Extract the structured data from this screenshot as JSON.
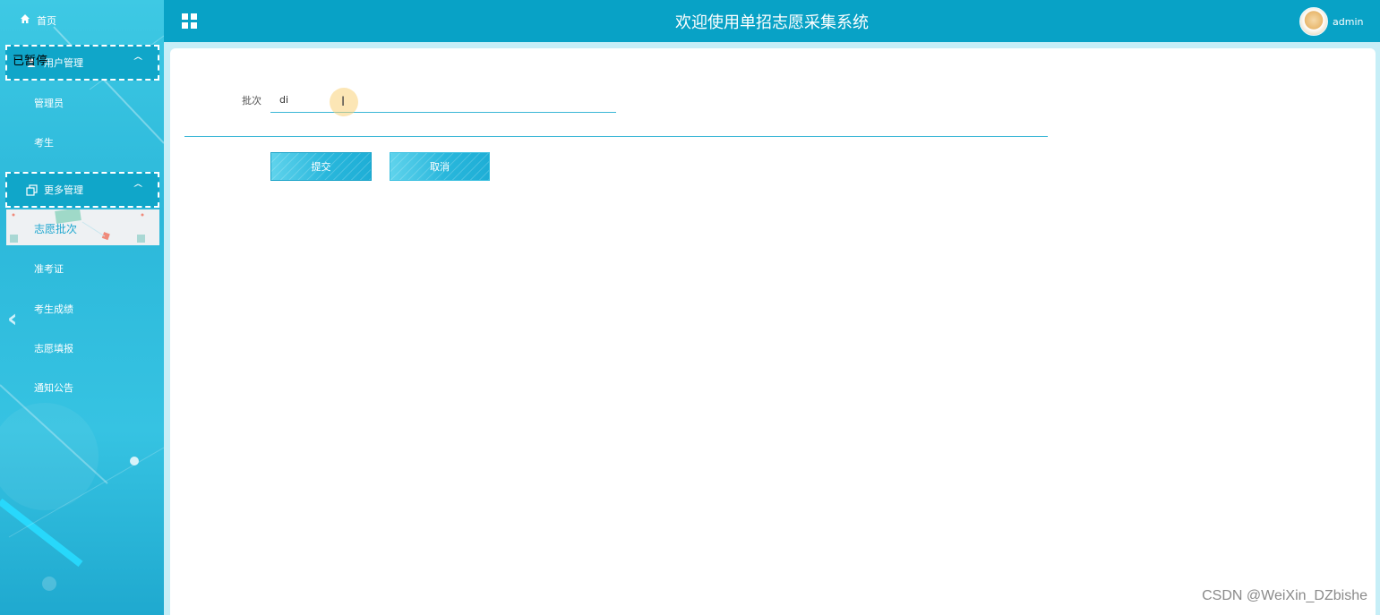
{
  "sidebar": {
    "home_label": "首页",
    "paused_label": "已暂停",
    "groups": [
      {
        "label": "用户管理",
        "caret": "^",
        "items": [
          "管理员",
          "考生"
        ]
      },
      {
        "label": "更多管理",
        "caret": "^",
        "items": [
          "志愿批次",
          "准考证",
          "考生成绩",
          "志愿填报",
          "通知公告"
        ]
      }
    ],
    "active_item": "志愿批次"
  },
  "header": {
    "title": "欢迎使用单招志愿采集系统",
    "username": "admin"
  },
  "form": {
    "batch_label": "批次",
    "batch_value": "di",
    "submit_label": "提交",
    "cancel_label": "取消"
  },
  "watermark": "CSDN @WeiXin_DZbishe",
  "colors": {
    "header_bg": "#08a2c6",
    "sidebar_bg": "#2cb8da",
    "accent": "#3bb7d6"
  }
}
